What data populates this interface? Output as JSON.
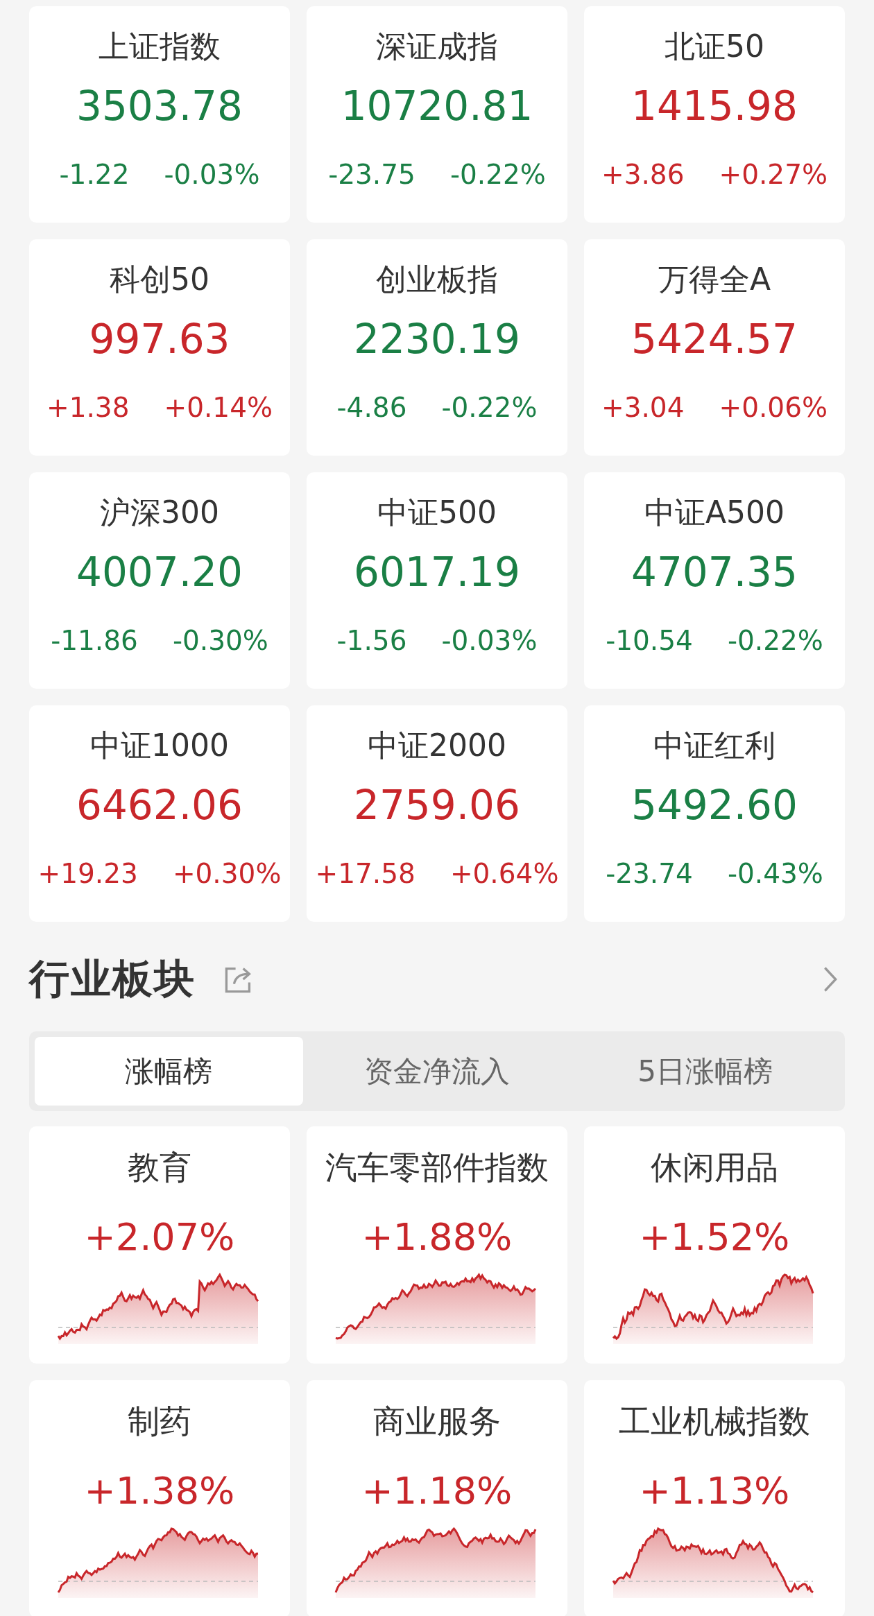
{
  "indices": [
    {
      "name": "上证指数",
      "value": "3503.78",
      "change": "-1.22",
      "percent": "-0.03%",
      "rising": false
    },
    {
      "name": "深证成指",
      "value": "10720.81",
      "change": "-23.75",
      "percent": "-0.22%",
      "rising": false
    },
    {
      "name": "北证50",
      "value": "1415.98",
      "change": "+3.86",
      "percent": "+0.27%",
      "rising": true
    },
    {
      "name": "科创50",
      "value": "997.63",
      "change": "+1.38",
      "percent": "+0.14%",
      "rising": true
    },
    {
      "name": "创业板指",
      "value": "2230.19",
      "change": "-4.86",
      "percent": "-0.22%",
      "rising": false
    },
    {
      "name": "万得全A",
      "value": "5424.57",
      "change": "+3.04",
      "percent": "+0.06%",
      "rising": true
    },
    {
      "name": "沪深300",
      "value": "4007.20",
      "change": "-11.86",
      "percent": "-0.30%",
      "rising": false
    },
    {
      "name": "中证500",
      "value": "6017.19",
      "change": "-1.56",
      "percent": "-0.03%",
      "rising": false
    },
    {
      "name": "中证A500",
      "value": "4707.35",
      "change": "-10.54",
      "percent": "-0.22%",
      "rising": false
    },
    {
      "name": "中证1000",
      "value": "6462.06",
      "change": "+19.23",
      "percent": "+0.30%",
      "rising": true
    },
    {
      "name": "中证2000",
      "value": "2759.06",
      "change": "+17.58",
      "percent": "+0.64%",
      "rising": true
    },
    {
      "name": "中证红利",
      "value": "5492.60",
      "change": "-23.74",
      "percent": "-0.43%",
      "rising": false
    }
  ],
  "section": {
    "title": "行业板块"
  },
  "tabs": [
    {
      "label": "涨幅榜",
      "selected": true
    },
    {
      "label": "资金净流入",
      "selected": false
    },
    {
      "label": "5日涨幅榜",
      "selected": false
    }
  ],
  "sectors": [
    {
      "name": "教育",
      "percent": "+2.07%",
      "rising": true
    },
    {
      "name": "汽车零部件指数",
      "percent": "+1.88%",
      "rising": true
    },
    {
      "name": "休闲用品",
      "percent": "+1.52%",
      "rising": true
    },
    {
      "name": "制药",
      "percent": "+1.38%",
      "rising": true
    },
    {
      "name": "商业服务",
      "percent": "+1.18%",
      "rising": true
    },
    {
      "name": "工业机械指数",
      "percent": "+1.13%",
      "rising": true
    }
  ]
}
